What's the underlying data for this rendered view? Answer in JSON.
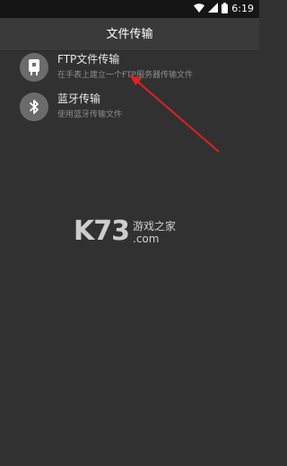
{
  "status_bar": {
    "time": "6:19",
    "icons": [
      "wifi-icon",
      "signal-icon",
      "battery-icon"
    ]
  },
  "app_bar": {
    "title": "文件传输"
  },
  "items": [
    {
      "title": "FTP文件传输",
      "subtitle": "在手表上建立一个FTP服务器传输文件",
      "icon": "ftp-device-icon"
    },
    {
      "title": "蓝牙传输",
      "subtitle": "使用蓝牙传输文件",
      "icon": "bluetooth-icon"
    }
  ],
  "watermark": {
    "brand": "K73",
    "cn": "游戏之家",
    "domain": ".com"
  },
  "colors": {
    "background": "#313131",
    "app_bar": "#3a3a3a",
    "status_bar": "#151515",
    "icon_circle": "#6b6b6b",
    "arrow": "#e02020"
  }
}
